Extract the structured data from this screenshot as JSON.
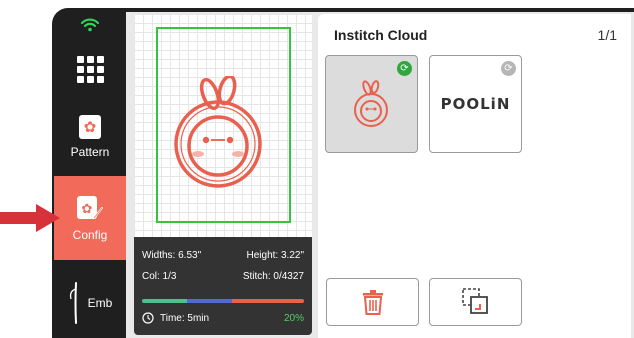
{
  "sidebar": {
    "pattern_label": "Pattern",
    "config_label": "Config",
    "emb_label": "Emb",
    "active": "Config"
  },
  "info": {
    "width_text": "Widths: 6.53\"",
    "height_text": "Height: 3.22\"",
    "col_text": "Col: 1/3",
    "stitch_text": "Stitch: 0/4327",
    "time_text": "Time: 5min",
    "percent_text": "20%"
  },
  "cloud": {
    "title": "Institch Cloud",
    "page": "1/1",
    "thumbnails": [
      {
        "name": "bunny-face-design",
        "selected": true,
        "synced": true
      },
      {
        "name": "poolin-logo-design",
        "text": "POOLiN",
        "selected": false,
        "synced": false
      }
    ]
  },
  "colors": {
    "accent": "#f26a59",
    "hoop": "#36c43c",
    "sync_on": "#2ea83e",
    "sync_off": "#b6b6b6",
    "progress": [
      "#4fc08d",
      "#5468d4",
      "#e8614f"
    ]
  }
}
